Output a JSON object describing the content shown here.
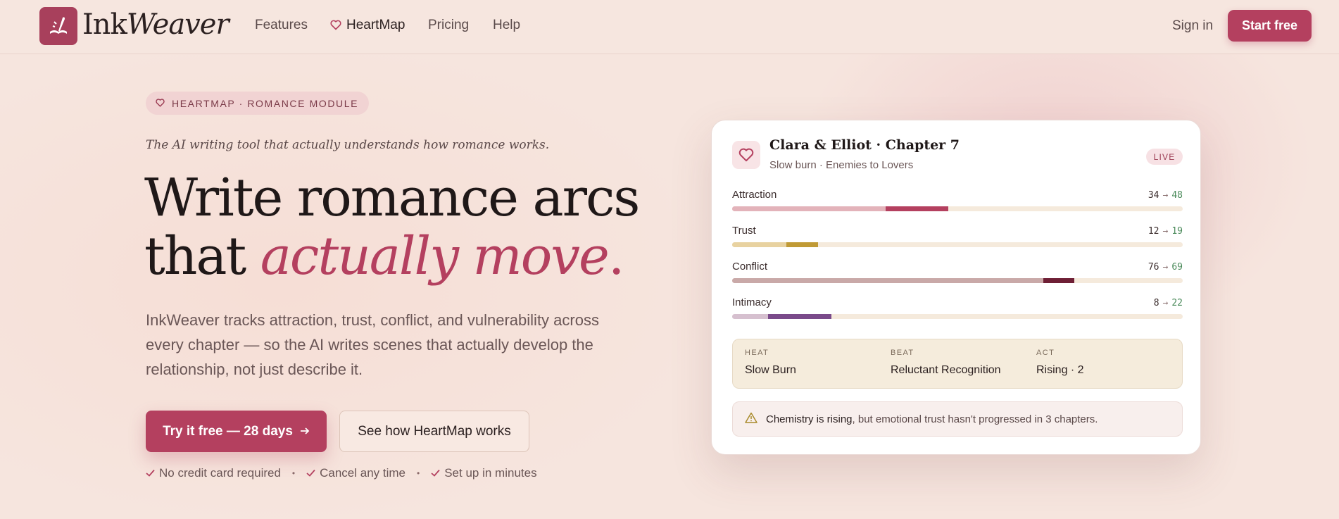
{
  "brand": {
    "name_part1": "Ink",
    "name_part2": "Weaver"
  },
  "nav": {
    "links": [
      {
        "label": "Features"
      },
      {
        "label": "HeartMap"
      },
      {
        "label": "Pricing"
      },
      {
        "label": "Help"
      }
    ],
    "signin": "Sign in",
    "start_free": "Start free"
  },
  "hero": {
    "badge": "HEARTMAP · ROMANCE MODULE",
    "tagline": "The AI writing tool that actually understands how romance works.",
    "headline_line1": "Write romance arcs",
    "headline_line2_plain": "that ",
    "headline_line2_accent": "actually move",
    "headline_line2_end": ".",
    "description": "InkWeaver tracks attraction, trust, conflict, and vulnerability across every chapter — so the AI writes scenes that actually develop the relationship, not just describe it.",
    "cta_primary": "Try it free — 28 days",
    "cta_secondary": "See how HeartMap works",
    "checks": [
      "No credit card required",
      "Cancel any time",
      "Set up in minutes"
    ]
  },
  "card": {
    "title": "Clara & Elliot · Chapter 7",
    "subtitle": "Slow burn · Enemies to Lovers",
    "status": "LIVE",
    "metrics": [
      {
        "label": "Attraction",
        "from": 34,
        "to": 48,
        "arrow": "→",
        "base_color": "#e3b3ba",
        "delta_color": "#b4405f"
      },
      {
        "label": "Trust",
        "from": 12,
        "to": 19,
        "arrow": "→",
        "base_color": "#e8d2a0",
        "delta_color": "#c09a35"
      },
      {
        "label": "Conflict",
        "from": 76,
        "to": 69,
        "arrow": "→",
        "base_color": "#c9a9a8",
        "delta_color": "#6e1f35"
      },
      {
        "label": "Intimacy",
        "from": 8,
        "to": 22,
        "arrow": "→",
        "base_color": "#d6c0cf",
        "delta_color": "#7a4a8a"
      }
    ],
    "stats": [
      {
        "label": "HEAT",
        "value": "Slow Burn"
      },
      {
        "label": "BEAT",
        "value": "Reluctant Recognition"
      },
      {
        "label": "ACT",
        "value": "Rising · 2"
      }
    ],
    "alert_strong": "Chemistry is rising",
    "alert_rest": ", but emotional trust hasn't progressed in 3 chapters."
  },
  "colors": {
    "accent": "#b4405f",
    "background": "#f6e5de"
  }
}
